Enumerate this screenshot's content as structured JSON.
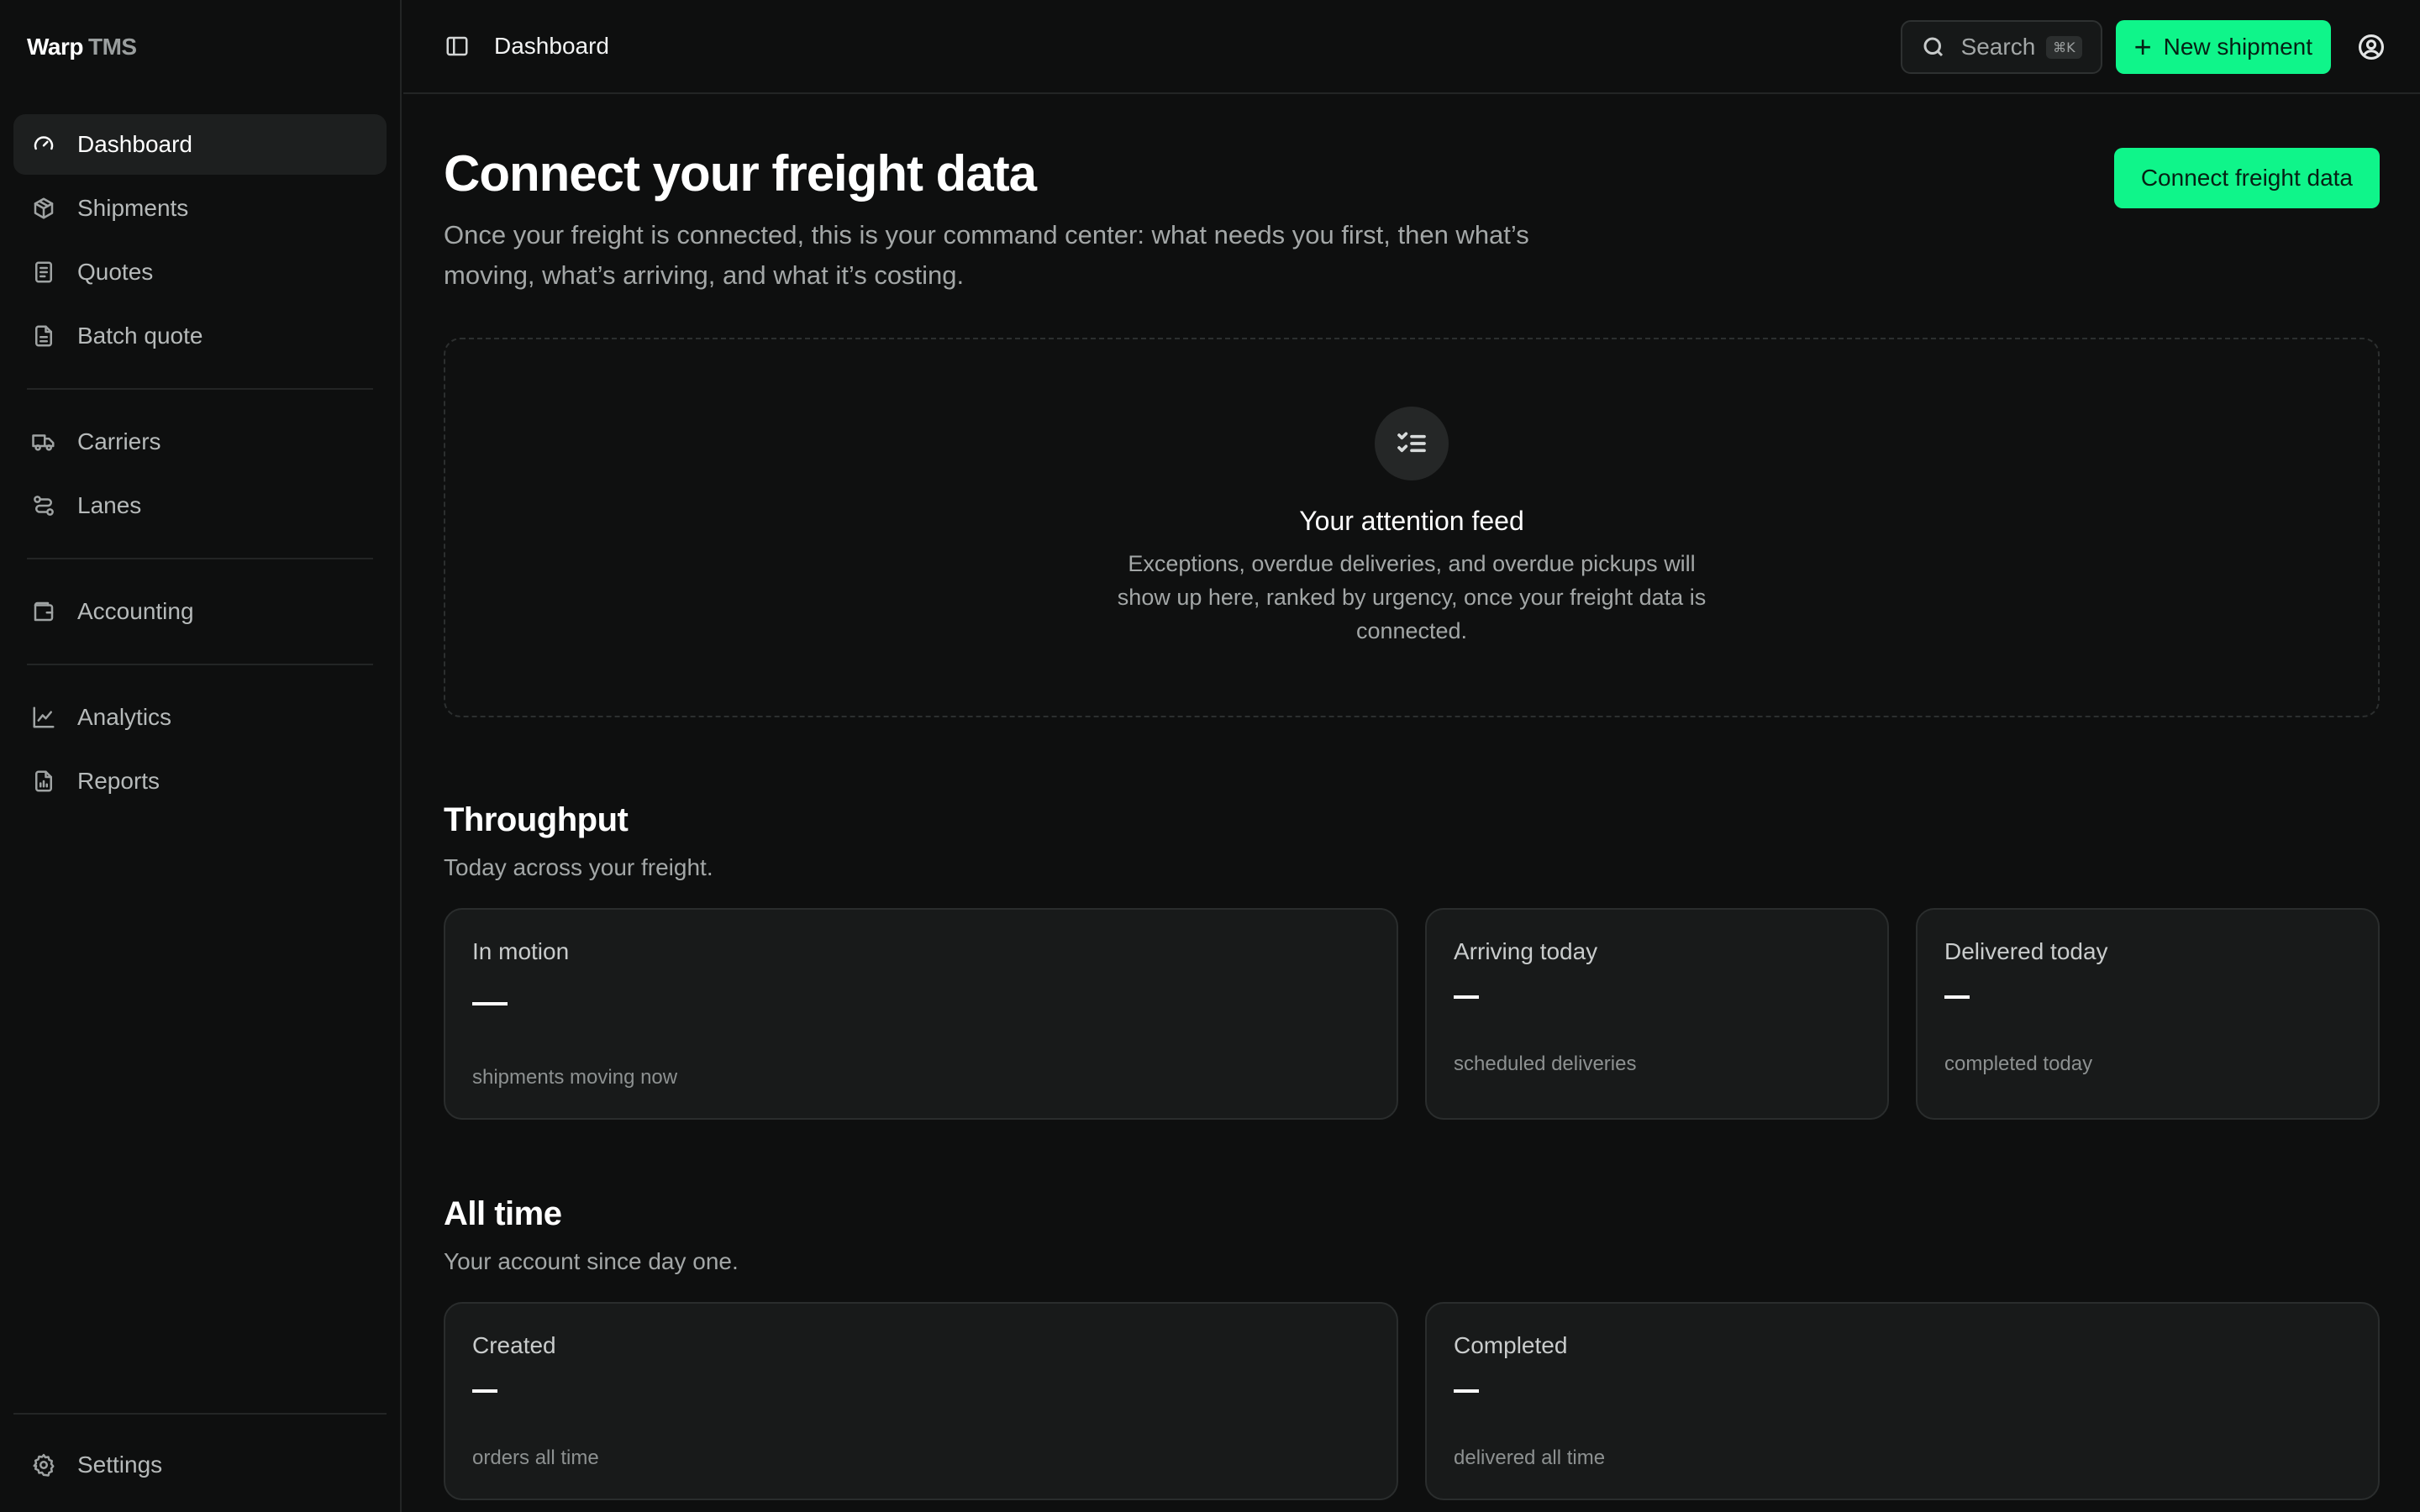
{
  "brand": {
    "name": "Warp",
    "suffix": "TMS"
  },
  "sidebar": {
    "items": [
      {
        "label": "Dashboard",
        "icon": "gauge-icon",
        "active": true
      },
      {
        "label": "Shipments",
        "icon": "package-icon"
      },
      {
        "label": "Quotes",
        "icon": "receipt-icon"
      },
      {
        "label": "Batch quote",
        "icon": "file-list-icon"
      },
      {
        "label": "Carriers",
        "icon": "truck-icon"
      },
      {
        "label": "Lanes",
        "icon": "route-icon"
      },
      {
        "label": "Accounting",
        "icon": "wallet-icon"
      },
      {
        "label": "Analytics",
        "icon": "line-chart-icon"
      },
      {
        "label": "Reports",
        "icon": "file-chart-icon"
      }
    ],
    "settings_label": "Settings"
  },
  "topbar": {
    "breadcrumb": "Dashboard",
    "search_label": "Search",
    "search_shortcut": "⌘K",
    "new_button": "New shipment"
  },
  "hero": {
    "title": "Connect your freight data",
    "description": "Once your freight is connected, this is your command center: what needs you first, then what’s moving, what’s arriving, and what it’s costing.",
    "connect_button": "Connect freight data"
  },
  "attention": {
    "title": "Your attention feed",
    "description": "Exceptions, overdue deliveries, and overdue pickups will show up here, ranked by urgency, once your freight data is connected."
  },
  "throughput": {
    "title": "Throughput",
    "subtitle": "Today across your freight.",
    "cards": [
      {
        "label": "In motion",
        "value": "—",
        "note": "shipments moving now"
      },
      {
        "label": "Arriving today",
        "value": "—",
        "note": "scheduled deliveries"
      },
      {
        "label": "Delivered today",
        "value": "—",
        "note": "completed today"
      }
    ]
  },
  "all_time": {
    "title": "All time",
    "subtitle": "Your account since day one.",
    "cards": [
      {
        "label": "Created",
        "value": "—",
        "note": "orders all time"
      },
      {
        "label": "Completed",
        "value": "—",
        "note": "delivered all time"
      }
    ]
  },
  "colors": {
    "accent": "#0ff58a",
    "background": "#0e0f0f",
    "card": "#181a1a"
  }
}
